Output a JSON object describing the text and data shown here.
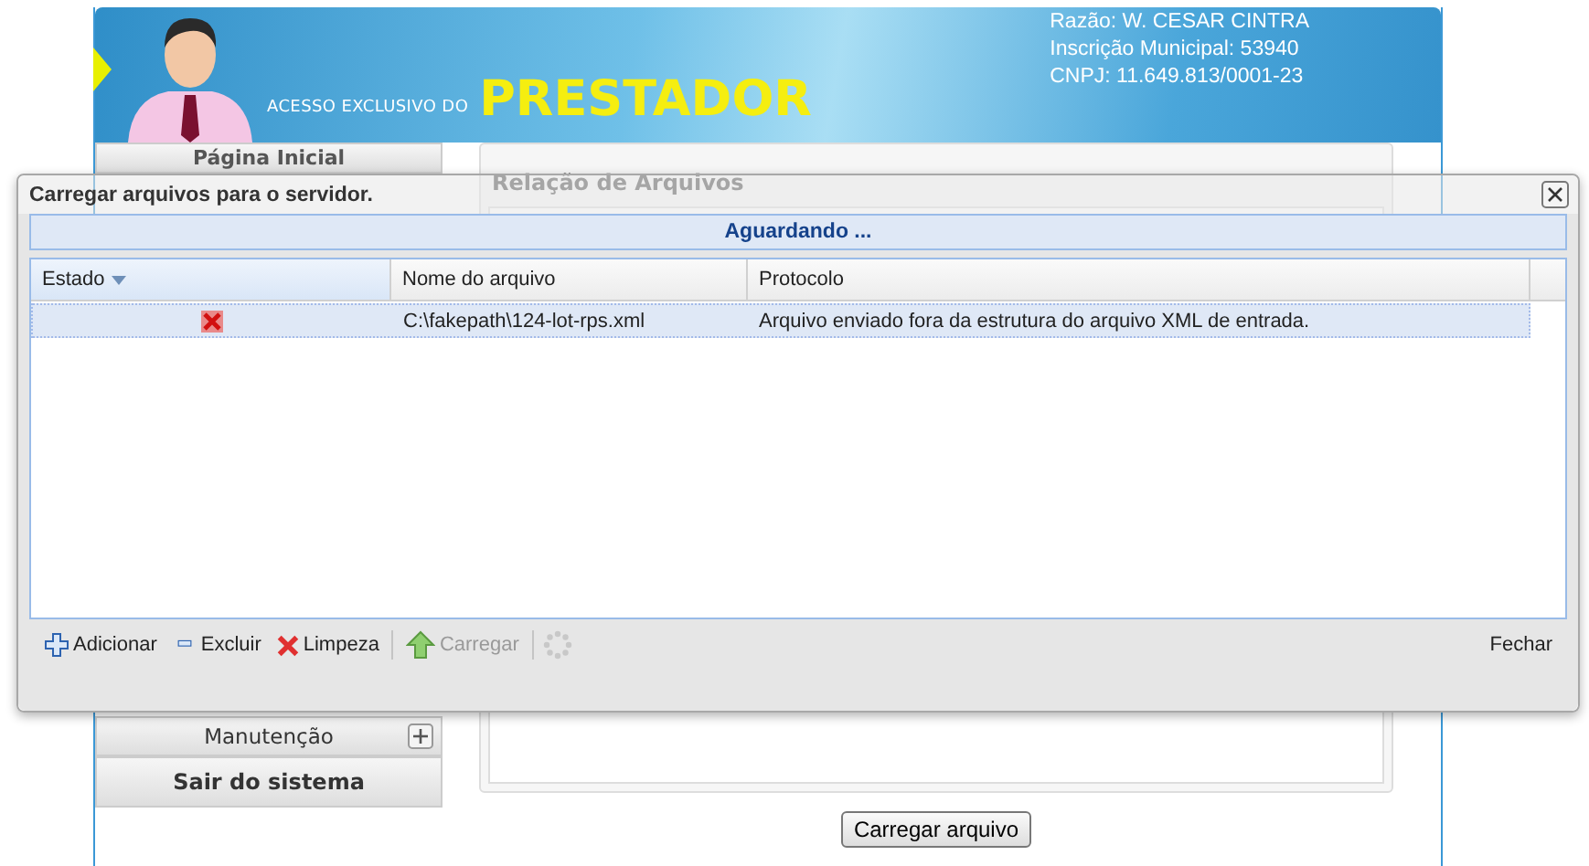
{
  "header": {
    "tagline": "ACESSO EXCLUSIVO DO",
    "title": "PRESTADOR",
    "info": [
      "Razão: W. CESAR CINTRA",
      "Inscrição Municipal: 53940",
      "CNPJ: 11.649.813/0001-23"
    ]
  },
  "sidebar": {
    "items": [
      {
        "label": "Página Inicial",
        "kind": "link"
      },
      {
        "label": "Manutenção",
        "kind": "expandable",
        "expanded": false
      },
      {
        "label": "Sair do sistema",
        "kind": "exit"
      }
    ]
  },
  "content": {
    "title": "Relação de Arquivos",
    "button": "Carregar arquivo"
  },
  "dialog": {
    "title": "Carregar arquivos para o servidor.",
    "status": "Aguardando ...",
    "table": {
      "columns": [
        {
          "label": "Estado",
          "sorted": true
        },
        {
          "label": "Nome do arquivo",
          "sorted": false
        },
        {
          "label": "Protocolo",
          "sorted": false
        }
      ],
      "rows": [
        {
          "kind": "error",
          "file": "C:\\fakepath\\124-lot-rps.xml",
          "protocol": "Arquivo enviado fora da estrutura do arquivo XML de entrada.",
          "selected": true
        }
      ]
    },
    "toolbar": [
      {
        "kind": "add",
        "label": "Adicionar",
        "disabled": false
      },
      {
        "kind": "remove",
        "label": "Excluir",
        "disabled": false
      },
      {
        "kind": "clear",
        "label": "Limpeza",
        "disabled": false
      },
      {
        "kind": "upload",
        "label": "Carregar",
        "disabled": true
      },
      {
        "kind": "spinner"
      }
    ],
    "close_label": "Fechar"
  }
}
